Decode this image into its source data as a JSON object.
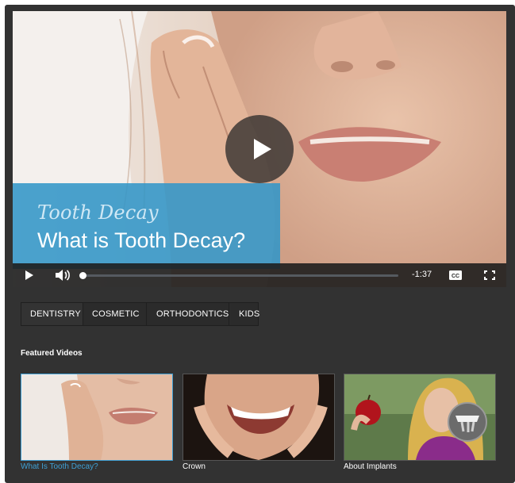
{
  "player": {
    "subtitle": "Tooth Decay",
    "title": "What is Tooth Decay?",
    "time_remaining": "-1:37",
    "progress_fraction": 0,
    "accent_color": "#3296c8",
    "controls": {
      "play_icon": "play-icon",
      "volume_icon": "volume-icon",
      "captions_label": "CC",
      "fullscreen_icon": "fullscreen-icon"
    }
  },
  "tabs": [
    {
      "label": "DENTISTRY",
      "active": true
    },
    {
      "label": "COSMETIC",
      "active": false
    },
    {
      "label": "ORTHODONTICS",
      "active": false
    },
    {
      "label": "KIDS",
      "active": false
    }
  ],
  "featured": {
    "heading": "Featured Videos",
    "items": [
      {
        "label": "What Is Tooth Decay?",
        "selected": true
      },
      {
        "label": "Crown",
        "selected": false
      },
      {
        "label": "About Implants",
        "selected": false
      }
    ],
    "selected_color": "#3f9fd3"
  }
}
